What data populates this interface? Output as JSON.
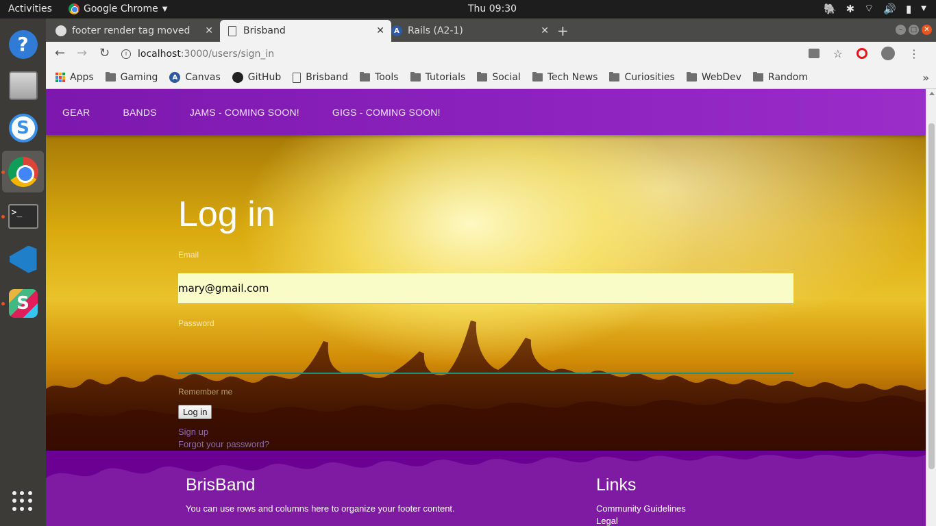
{
  "os": {
    "activities": "Activities",
    "app_name": "Google Chrome",
    "clock": "Thu 09:30"
  },
  "browser": {
    "tabs": [
      {
        "title": "footer render tag moved",
        "favicon": "github-icon"
      },
      {
        "title": "Brisband",
        "favicon": "document-icon",
        "active": true
      },
      {
        "title": "Rails (A2-1)",
        "favicon": "canvas-icon"
      }
    ],
    "url_host": "localhost",
    "url_path": ":3000/users/sign_in",
    "bookmarks": [
      {
        "label": "Apps",
        "icon": "apps-icon"
      },
      {
        "label": "Gaming",
        "icon": "folder-icon"
      },
      {
        "label": "Canvas",
        "icon": "canvas-icon"
      },
      {
        "label": "GitHub",
        "icon": "github-icon"
      },
      {
        "label": "Brisband",
        "icon": "document-icon"
      },
      {
        "label": "Tools",
        "icon": "folder-icon"
      },
      {
        "label": "Tutorials",
        "icon": "folder-icon"
      },
      {
        "label": "Social",
        "icon": "folder-icon"
      },
      {
        "label": "Tech News",
        "icon": "folder-icon"
      },
      {
        "label": "Curiosities",
        "icon": "folder-icon"
      },
      {
        "label": "WebDev",
        "icon": "folder-icon"
      },
      {
        "label": "Random",
        "icon": "folder-icon"
      }
    ]
  },
  "page": {
    "nav": [
      "GEAR",
      "BANDS",
      "JAMS - COMING SOON!",
      "GIGS - COMING SOON!"
    ],
    "title": "Log in",
    "email_label": "Email",
    "email_value": "mary@gmail.com",
    "password_label": "Password",
    "remember_label": "Remember me",
    "login_button": "Log in",
    "signup_link": "Sign up",
    "forgot_link": "Forgot your password?",
    "footer": {
      "brand_title": "BrisBand",
      "brand_text": "You can use rows and columns here to organize your footer content.",
      "links_title": "Links",
      "links": [
        "Community Guidelines",
        "Legal"
      ]
    }
  },
  "colors": {
    "nav_purple": "#8e23c0",
    "footer_purple": "#6c0093",
    "email_bg": "#fafcc8",
    "focus_teal": "#1f8f83"
  }
}
